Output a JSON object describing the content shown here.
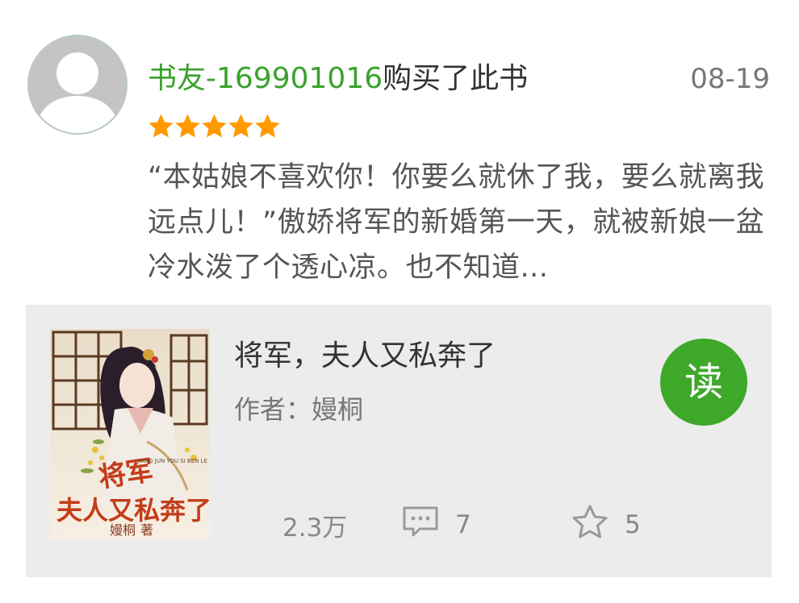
{
  "review": {
    "avatar_icon": "default-user-avatar-icon",
    "username": "书友-169901016",
    "action": "购买了此书",
    "date": "08-19",
    "rating": 5,
    "rating_max": 5,
    "star_color": "#ff9a00",
    "text": "“本姑娘不喜欢你！你要么就休了我，要么就离我远点儿！”傲娇将军的新婚第一天，就被新娘一盆冷水泼了个透心凉。也不知道..."
  },
  "book": {
    "cover_icon": "book-cover-image",
    "cover_title_text": "将军夫人又私奔了",
    "cover_pinyin_text": "JIANG JUN YOU SI BEN LE",
    "cover_author_text": "嫚桐",
    "cover_author_suffix": "著",
    "title": "将军，夫人又私奔了",
    "author_label": "作者：",
    "author": "嫚桐",
    "read_label": "读",
    "views": "2.3万",
    "comment_icon": "comment-icon",
    "comments": "7",
    "favorite_icon": "star-outline-icon",
    "favorites": "5",
    "accent_color": "#3ea82a",
    "username_color": "#3aa22c"
  }
}
